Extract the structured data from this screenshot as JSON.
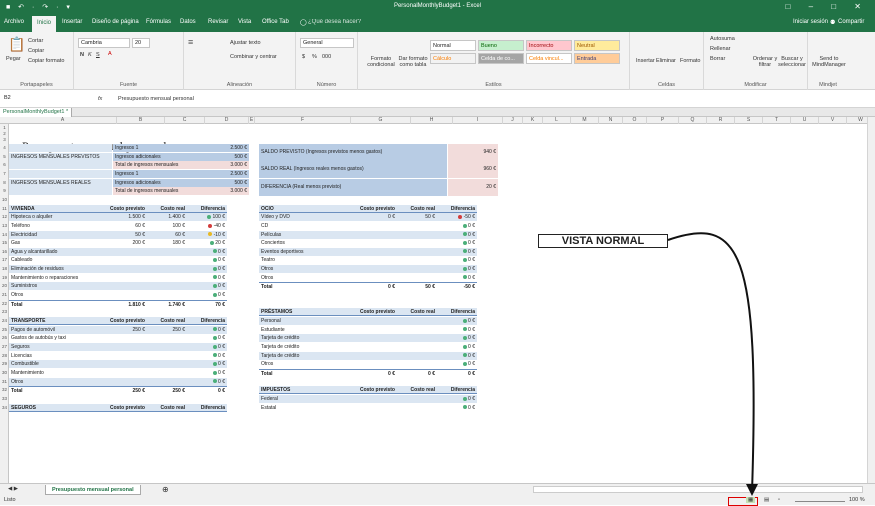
{
  "titlebar": {
    "title": "PersonalMonthlyBudget1 - Excel",
    "quick_access": "■  ↶ · ↷ · ▾",
    "window_controls": "□  –  □  ✕"
  },
  "menu": {
    "tabs": [
      "Archivo",
      "Inicio",
      "Insertar",
      "Diseño de página",
      "Fórmulas",
      "Datos",
      "Revisar",
      "Vista",
      "Office Tab"
    ],
    "search": "¿Qué desea hacer?",
    "login": "Iniciar sesión",
    "share": "Compartir"
  },
  "ribbon": {
    "clipboard": {
      "paste": "Pegar",
      "cut": "Cortar",
      "copy": "Copiar",
      "format_painter": "Copiar formato",
      "label": "Portapapeles"
    },
    "font": {
      "name": "Cambria",
      "size": "20",
      "label": "Fuente",
      "bold": "N",
      "italic": "K",
      "underline": "S"
    },
    "alignment": {
      "wrap": "Ajustar texto",
      "merge": "Combinar y centrar",
      "label": "Alineación"
    },
    "number": {
      "format": "General",
      "currency": "$",
      "percent": "%",
      "thousands": "000",
      "label": "Número"
    },
    "styles": {
      "cond": "Formato condicional",
      "table": "Dar formato como tabla",
      "normal": "Normal",
      "bueno": "Bueno",
      "incorrecto": "Incorrecto",
      "neutral": "Neutral",
      "calculo": "Cálculo",
      "celda_co": "Celda de co...",
      "celda_vinc": "Celda vincul...",
      "entrada": "Entrada",
      "label": "Estilos"
    },
    "cells": {
      "insert": "Insertar",
      "delete": "Eliminar",
      "format": "Formato",
      "label": "Celdas"
    },
    "edit": {
      "autosum": "Autosuma",
      "fill": "Rellenar",
      "clear": "Borrar",
      "sort": "Ordenar y filtrar",
      "find": "Buscar y seleccionar",
      "label": "Modificar"
    },
    "mindjet": {
      "send": "Send to MindManager",
      "label": "Mindjet"
    }
  },
  "formula_bar": {
    "cell_ref": "B2",
    "fx": "fx",
    "value": "Presupuesto mensual personal"
  },
  "workbook_tab": {
    "label": "PersonalMonthlyBudget1 *"
  },
  "columns": [
    "A",
    "B",
    "C",
    "D",
    "E",
    "F",
    "G",
    "H",
    "I",
    "J",
    "K",
    "L",
    "M",
    "N",
    "O",
    "P",
    "Q",
    "R",
    "S",
    "T",
    "U",
    "V",
    "W"
  ],
  "rows": [
    "1",
    "2",
    "3",
    "4",
    "5",
    "6",
    "7",
    "8",
    "9",
    "10",
    "11",
    "12",
    "13",
    "14",
    "15",
    "16",
    "17",
    "18",
    "19",
    "20",
    "21",
    "22",
    "23",
    "24",
    "25",
    "26",
    "27",
    "28",
    "29",
    "30",
    "31",
    "32",
    "33",
    "34"
  ],
  "sheet": {
    "title": "Presupuesto mensual personal",
    "income": {
      "prev_label": "INGRESOS MENSUALES PREVISTOS",
      "real_label": "INGRESOS MENSUALES REALES",
      "prev": [
        [
          "Ingresos 1",
          "2.500 €"
        ],
        [
          "Ingresos adicionales",
          "500 €"
        ],
        [
          "Total de ingresos mensuales",
          "3.000 €"
        ]
      ],
      "real": [
        [
          "Ingresos 1",
          "2.500 €"
        ],
        [
          "Ingresos adicionales",
          "500 €"
        ],
        [
          "Total de ingresos mensuales",
          "3.000 €"
        ]
      ]
    },
    "balance": [
      [
        "SALDO PREVISTO (Ingresos previstos menos gastos)",
        "940 €"
      ],
      [
        "SALDO REAL (Ingresos reales menos gastos)",
        "960 €"
      ],
      [
        "DIFERENCIA (Real menos previsto)",
        "20 €"
      ]
    ],
    "headers": {
      "prev": "Costo previsto",
      "real": "Costo real",
      "diff": "Diferencia"
    },
    "vivienda": {
      "title": "VIVIENDA",
      "rows": [
        [
          "Hipoteca o alquiler",
          "1.500 €",
          "1.400 €",
          "100 €"
        ],
        [
          "Teléfono",
          "60 €",
          "100 €",
          "-40 €"
        ],
        [
          "Electricidad",
          "50 €",
          "60 €",
          "-10 €"
        ],
        [
          "Gas",
          "200 €",
          "180 €",
          "20 €"
        ],
        [
          "Agua y alcantarillado",
          "",
          "",
          "0 €"
        ],
        [
          "Cableado",
          "",
          "",
          "0 €"
        ],
        [
          "Eliminación de residuos",
          "",
          "",
          "0 €"
        ],
        [
          "Mantenimiento o reparaciones",
          "",
          "",
          "0 €"
        ],
        [
          "Suministros",
          "",
          "",
          "0 €"
        ],
        [
          "Otros",
          "",
          "",
          "0 €"
        ]
      ],
      "total": [
        "Total",
        "1.810 €",
        "1.740 €",
        "70 €"
      ]
    },
    "transporte": {
      "title": "TRANSPORTE",
      "rows": [
        [
          "Pagos de automóvil",
          "250 €",
          "250 €",
          "0 €"
        ],
        [
          "Gastos de autobús y taxi",
          "",
          "",
          "0 €"
        ],
        [
          "Seguros",
          "",
          "",
          "0 €"
        ],
        [
          "Licencias",
          "",
          "",
          "0 €"
        ],
        [
          "Combustible",
          "",
          "",
          "0 €"
        ],
        [
          "Mantenimiento",
          "",
          "",
          "0 €"
        ],
        [
          "Otros",
          "",
          "",
          "0 €"
        ]
      ],
      "total": [
        "Total",
        "250 €",
        "250 €",
        "0 €"
      ]
    },
    "seguros": {
      "title": "SEGUROS"
    },
    "ocio": {
      "title": "OCIO",
      "rows": [
        [
          "Vídeo y DVD",
          "0 €",
          "50 €",
          "-50 €"
        ],
        [
          "CD",
          "",
          "",
          "0 €"
        ],
        [
          "Películas",
          "",
          "",
          "0 €"
        ],
        [
          "Conciertos",
          "",
          "",
          "0 €"
        ],
        [
          "Eventos deportivos",
          "",
          "",
          "0 €"
        ],
        [
          "Teatro",
          "",
          "",
          "0 €"
        ],
        [
          "Otros",
          "",
          "",
          "0 €"
        ],
        [
          "Otros",
          "",
          "",
          "0 €"
        ]
      ],
      "total": [
        "Total",
        "0 €",
        "50 €",
        "-50 €"
      ]
    },
    "prestamos": {
      "title": "PRÉSTAMOS",
      "rows": [
        [
          "Personal",
          "",
          "",
          "0 €"
        ],
        [
          "Estudiante",
          "",
          "",
          "0 €"
        ],
        [
          "Tarjeta de crédito",
          "",
          "",
          "0 €"
        ],
        [
          "Tarjeta de crédito",
          "",
          "",
          "0 €"
        ],
        [
          "Tarjeta de crédito",
          "",
          "",
          "0 €"
        ],
        [
          "Otros",
          "",
          "",
          "0 €"
        ]
      ],
      "total": [
        "Total",
        "0 €",
        "0 €",
        "0 €"
      ]
    },
    "impuestos": {
      "title": "IMPUESTOS",
      "rows": [
        [
          "Federal",
          "",
          "",
          "0 €"
        ],
        [
          "Estatal",
          "",
          "",
          "0 €"
        ]
      ]
    }
  },
  "annotation": {
    "label": "VISTA NORMAL"
  },
  "status": {
    "ready": "Listo",
    "sheet_tab": "Presupuesto mensual personal",
    "add_sheet": "⊕",
    "zoom": "100 %"
  },
  "colors": {
    "green": "#217346",
    "light_blue": "#dbe6f2",
    "blue": "#b8cce4",
    "pink": "#f2dcdb",
    "dot_green": "#4caf7a",
    "dot_red": "#d23c3c",
    "dot_yellow": "#e8b923"
  }
}
